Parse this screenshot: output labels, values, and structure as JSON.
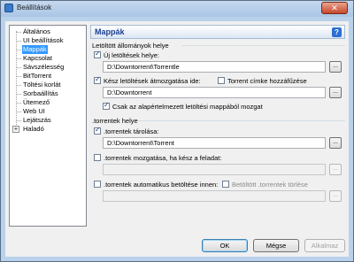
{
  "window": {
    "title": "Beállítások",
    "close_label": "✕"
  },
  "tree": {
    "items": [
      {
        "label": "Általános"
      },
      {
        "label": "UI beállítások"
      },
      {
        "label": "Mappák",
        "selected": true
      },
      {
        "label": "Kapcsolat"
      },
      {
        "label": "Sávszélesség"
      },
      {
        "label": "BitTorrent"
      },
      {
        "label": "Töltési korlát"
      },
      {
        "label": "Sorbaállítás"
      },
      {
        "label": "Ütemező"
      },
      {
        "label": "Web UI"
      },
      {
        "label": "Lejátszás"
      },
      {
        "label": "Haladó",
        "expander": "+"
      }
    ]
  },
  "panel": {
    "title": "Mappák",
    "help_label": "?"
  },
  "downloads": {
    "group_label": "Letöltött állományok helye",
    "new_label": "Új letöltések helye:",
    "new_checked": true,
    "new_path": "D:\\Downtorrent\\Torrentle",
    "move_label": "Kész letöltések átmozgatása ide:",
    "move_checked": true,
    "tag_label": "Torrent címke hozzáfűzése",
    "tag_checked": false,
    "move_path": "D:\\Downtorrent",
    "only_default_label": "Csak az alapértelmezett letöltési mappából mozgat",
    "only_default_checked": true
  },
  "torrents": {
    "group_label": ".torrentek helye",
    "store_label": ".torrentek tárolása:",
    "store_checked": true,
    "store_path": "D:\\Downtorrent\\Torrent",
    "move_done_label": ".torrentek mozgatása, ha kész a feladat:",
    "move_done_checked": false,
    "move_done_path": "",
    "autoload_label": ".torrentek automatikus betöltése innen:",
    "autoload_checked": false,
    "delete_loaded_label": "Betöltött .torrentek törlése",
    "delete_loaded_checked": false,
    "autoload_path": ""
  },
  "browse_label": "...",
  "buttons": {
    "ok": "OK",
    "cancel": "Mégse",
    "apply": "Alkalmaz"
  }
}
